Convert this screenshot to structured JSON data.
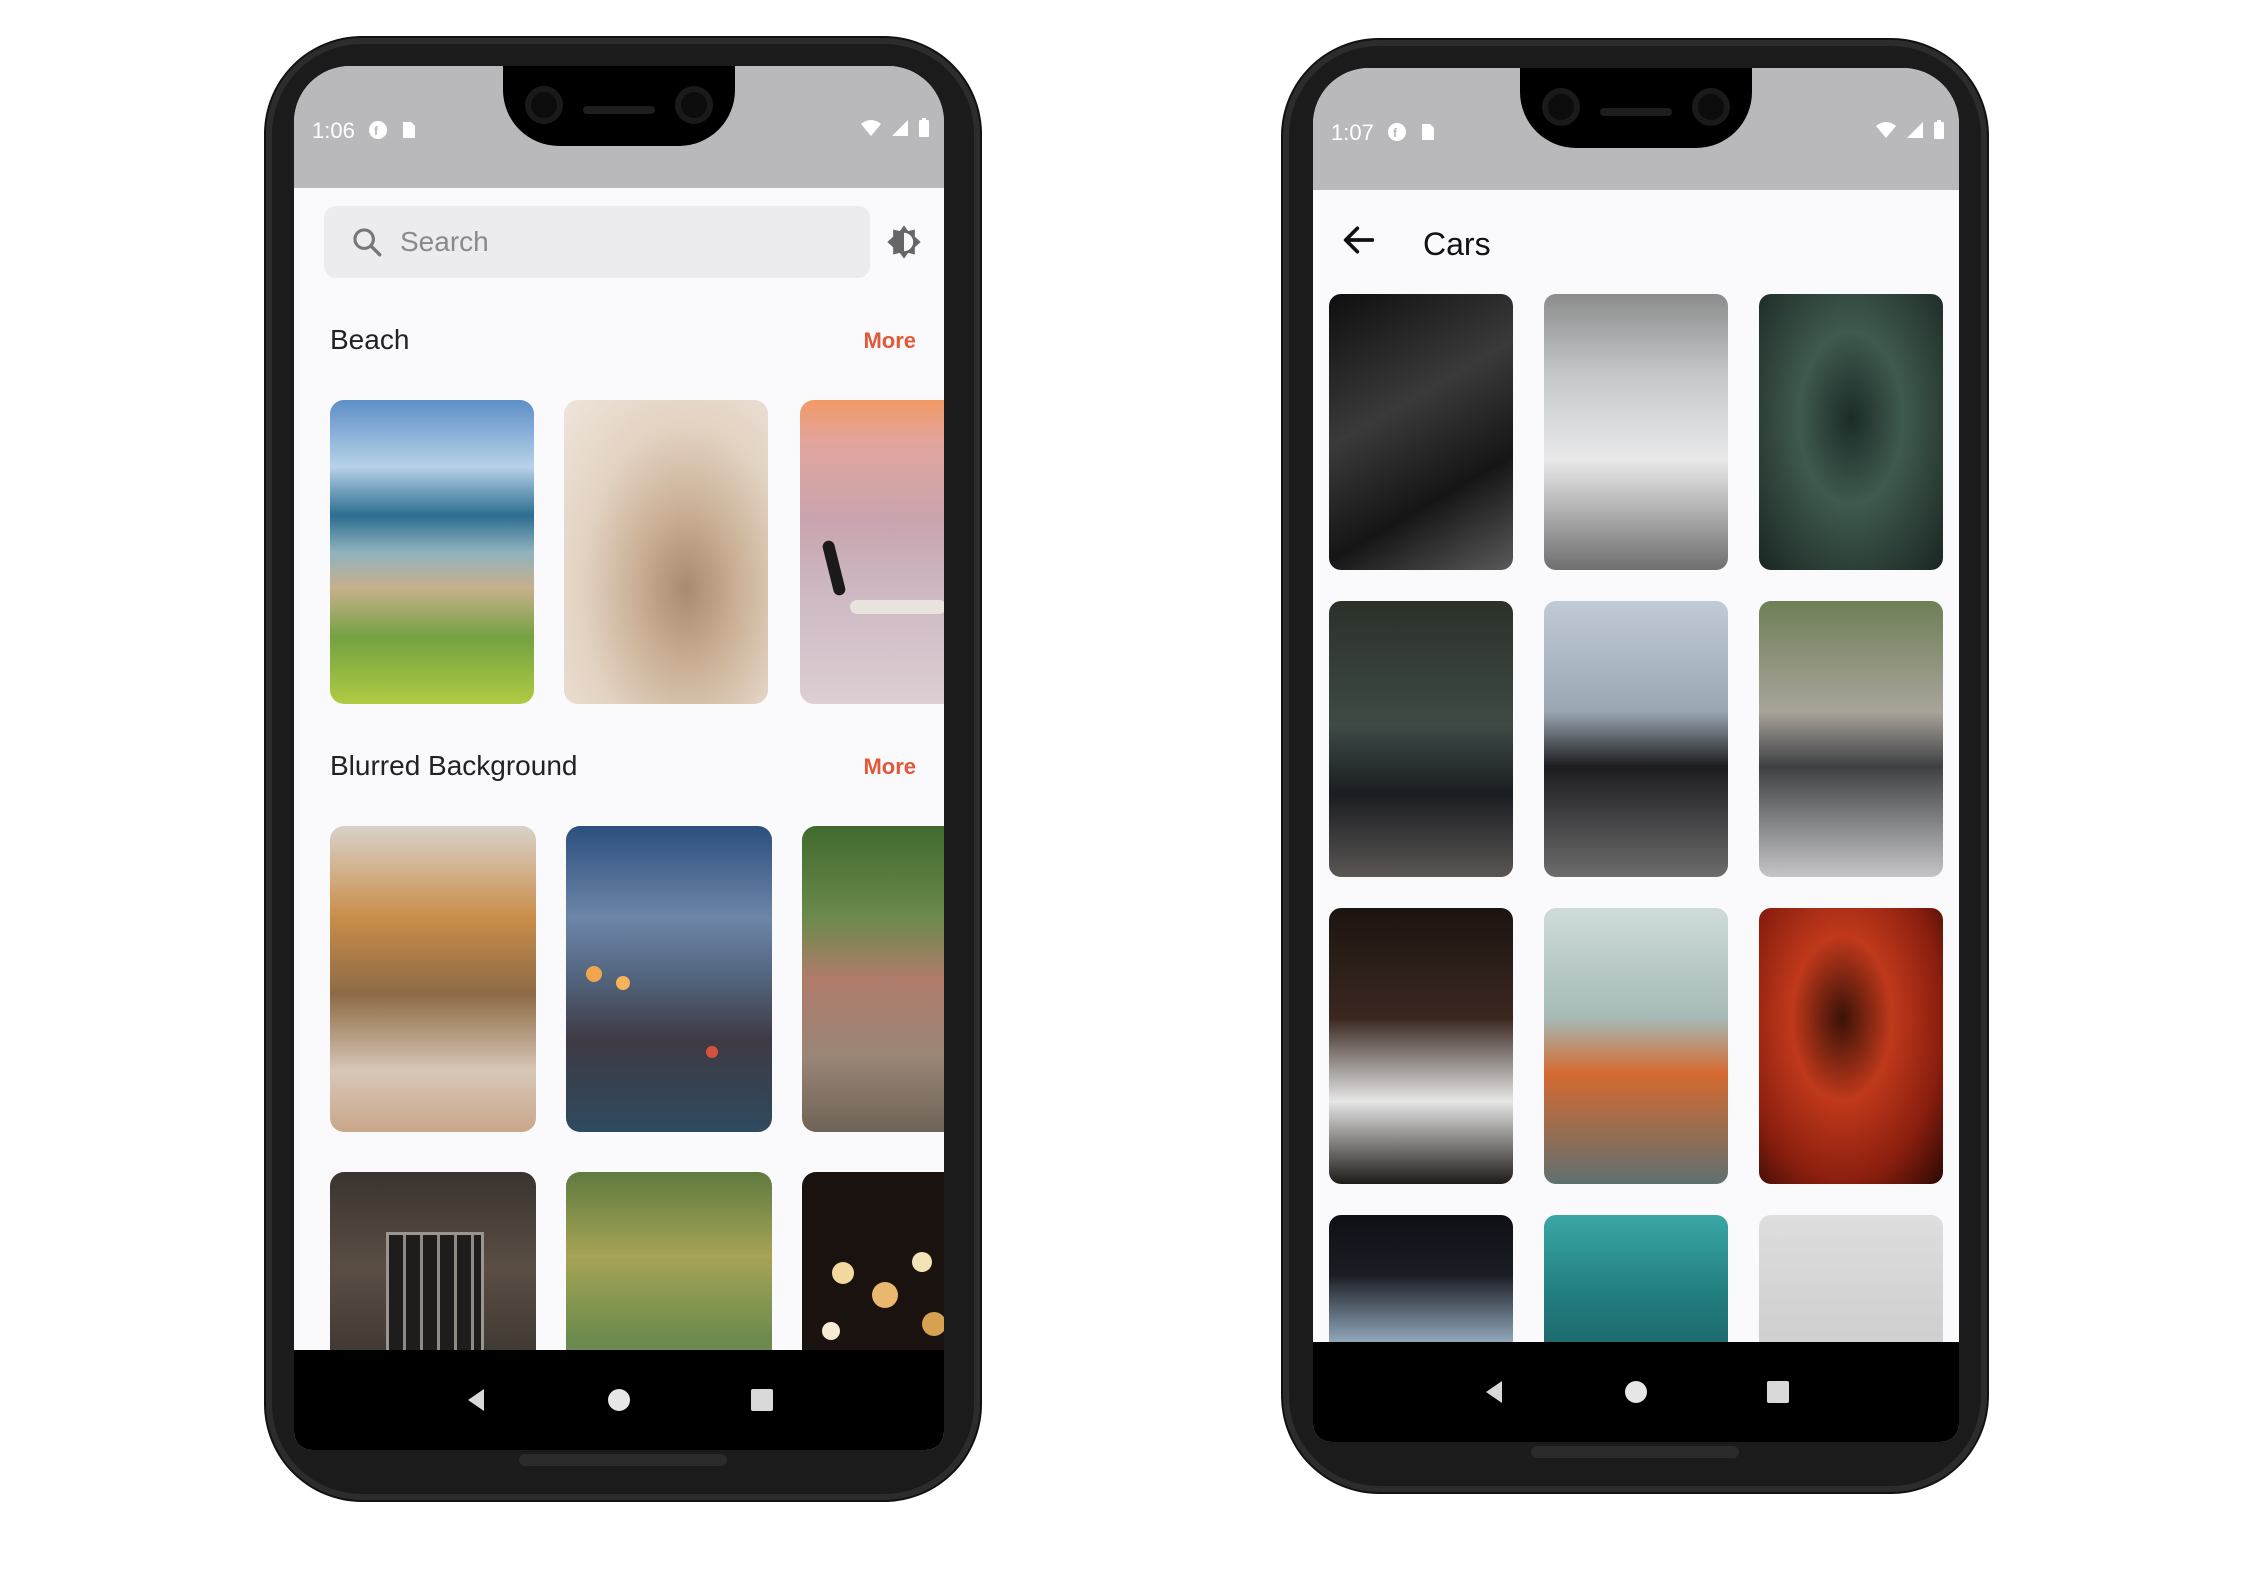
{
  "left_phone": {
    "status_time": "1:06",
    "search": {
      "placeholder": "Search",
      "value": ""
    },
    "sections": [
      {
        "title": "Beach",
        "more_label": "More"
      },
      {
        "title": "Blurred Background",
        "more_label": "More"
      }
    ]
  },
  "right_phone": {
    "status_time": "1:07",
    "page_title": "Cars"
  },
  "icons": {
    "search": "search-icon",
    "theme": "brightness-icon",
    "back": "arrow-back-icon",
    "nav_back": "triangle-back-icon",
    "nav_home": "circle-home-icon",
    "nav_recents": "square-recents-icon"
  },
  "colors": {
    "accent": "#e05a3a",
    "status_bar": "#b9b9bb",
    "background": "#fafafd"
  }
}
